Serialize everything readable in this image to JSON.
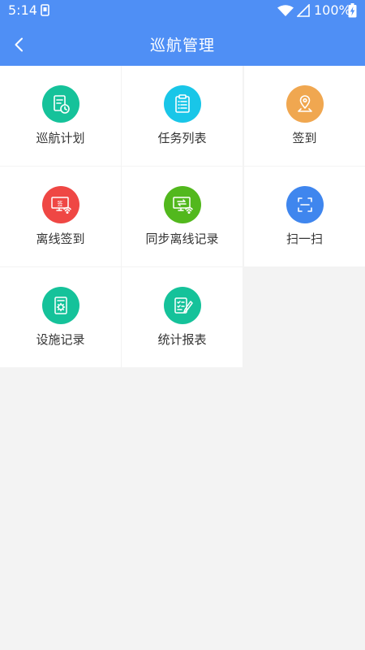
{
  "status_bar": {
    "time": "5:14",
    "battery": "100%"
  },
  "header": {
    "title": "巡航管理"
  },
  "colors": {
    "header_bg": "#4f8ff5",
    "page_bg": "#f3f3f3"
  },
  "tiles": [
    {
      "label": "巡航计划",
      "icon": "plan-clock-icon",
      "color": "#15c29a"
    },
    {
      "label": "任务列表",
      "icon": "clipboard-list-icon",
      "color": "#19c6e8"
    },
    {
      "label": "签到",
      "icon": "location-pin-icon",
      "color": "#f0a750"
    },
    {
      "label": "离线签到",
      "icon": "offline-sign-icon",
      "color": "#ef4744"
    },
    {
      "label": "同步离线记录",
      "icon": "sync-record-icon",
      "color": "#52b81d"
    },
    {
      "label": "扫一扫",
      "icon": "scan-icon",
      "color": "#3f86ee"
    },
    {
      "label": "设施记录",
      "icon": "facility-icon",
      "color": "#15c29a"
    },
    {
      "label": "统计报表",
      "icon": "report-icon",
      "color": "#15c29a"
    }
  ],
  "icon_text": {
    "offline_sign": "签"
  }
}
